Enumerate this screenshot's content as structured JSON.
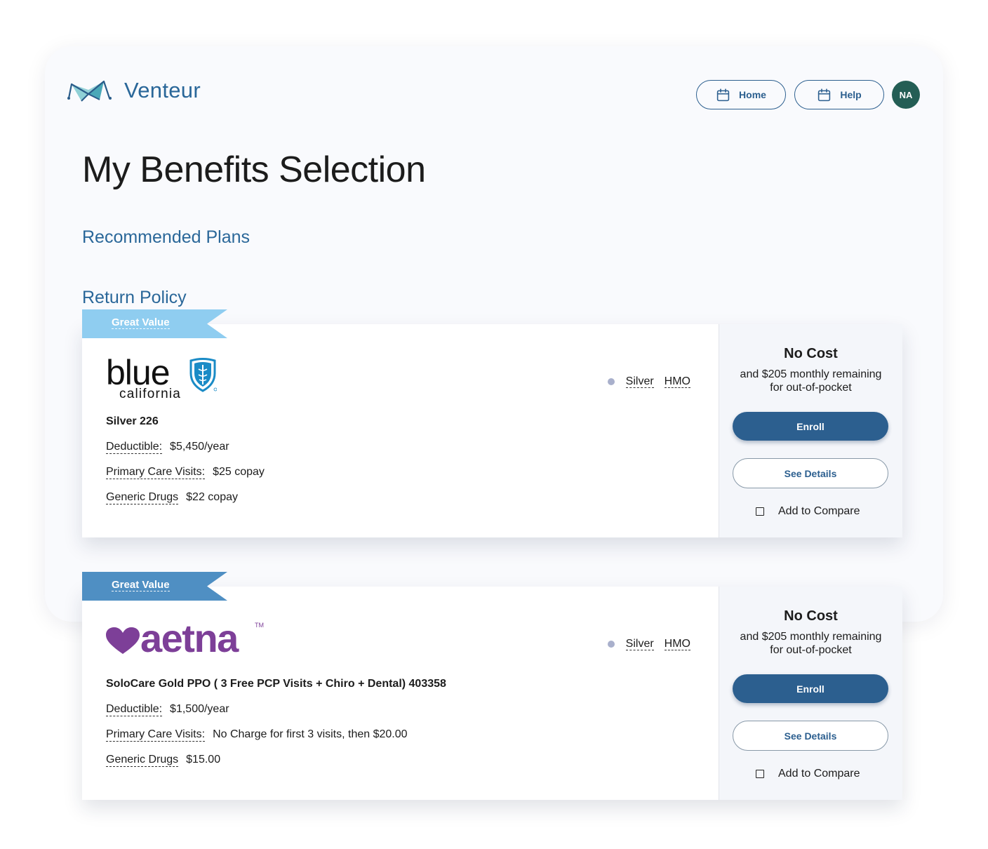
{
  "app": {
    "name": "Venteur"
  },
  "nav": {
    "home_label": "Home",
    "help_label": "Help",
    "avatar_initials": "NA"
  },
  "page": {
    "title": "My Benefits Selection",
    "sections": [
      "Recommended Plans",
      "Return Policy"
    ]
  },
  "colors": {
    "brand": "#2a6799",
    "primary_button": "#2c5f8f",
    "avatar": "#245e55",
    "ribbon_light": "#8fcdf0",
    "ribbon_dark": "#4f8fc3",
    "aetna": "#7d3f98"
  },
  "plans": [
    {
      "ribbon": "Great Value",
      "carrier": {
        "word": "blue",
        "sub": "california",
        "icon": "shield-caduceus-icon"
      },
      "tier": "Silver",
      "type": "HMO",
      "name": "Silver 226",
      "deductible_label": "Deductible:",
      "deductible": "$5,450/year",
      "pcp_label": "Primary Care Visits:",
      "pcp": "$25 copay",
      "drugs_label": "Generic Drugs",
      "drugs": "$22 copay",
      "cost_title": "No Cost",
      "cost_line1": "and $205 monthly remaining",
      "cost_line2": "for out-of-pocket",
      "enroll_label": "Enroll",
      "details_label": "See Details",
      "compare_label": "Add to Compare"
    },
    {
      "ribbon": "Great Value",
      "carrier": {
        "word": "aetna",
        "tm": "TM",
        "icon": "heart-icon"
      },
      "tier": "Silver",
      "type": "HMO",
      "name": "SoloCare Gold PPO ( 3 Free PCP Visits + Chiro + Dental) 403358",
      "deductible_label": "Deductible:",
      "deductible": "$1,500/year",
      "pcp_label": "Primary Care Visits:",
      "pcp": "No Charge for first 3 visits, then $20.00",
      "drugs_label": "Generic Drugs",
      "drugs": "$15.00",
      "cost_title": "No Cost",
      "cost_line1": "and $205 monthly remaining",
      "cost_line2": "for out-of-pocket",
      "enroll_label": "Enroll",
      "details_label": "See Details",
      "compare_label": "Add to Compare"
    }
  ]
}
